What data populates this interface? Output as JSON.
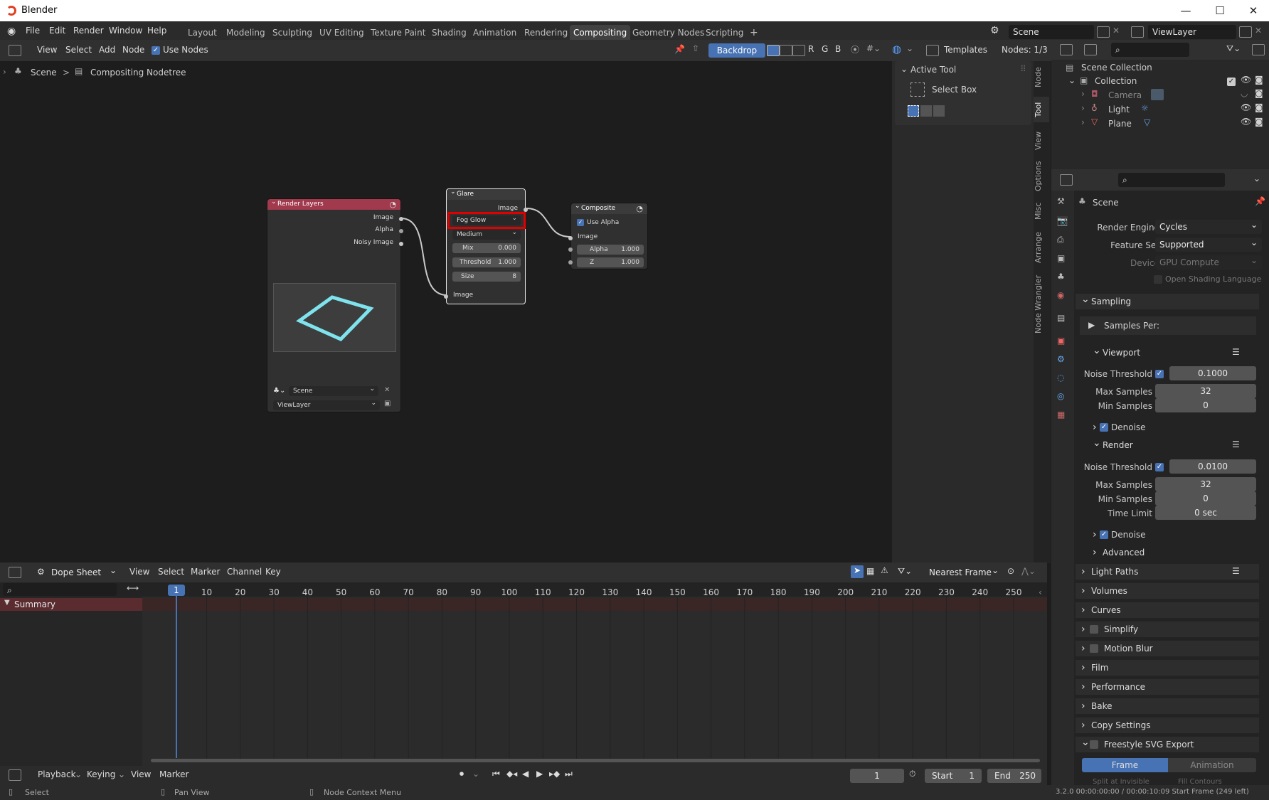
{
  "window": {
    "title": "Blender",
    "min": "—",
    "max": "☐",
    "close": "✕"
  },
  "menu": [
    "File",
    "Edit",
    "Render",
    "Window",
    "Help"
  ],
  "workspaces": [
    "Layout",
    "Modeling",
    "Sculpting",
    "UV Editing",
    "Texture Paint",
    "Shading",
    "Animation",
    "Rendering",
    "Compositing",
    "Geometry Nodes",
    "Scripting"
  ],
  "workspace_add": "+",
  "active_workspace": "Compositing",
  "scene_field": "Scene",
  "viewlayer_field": "ViewLayer",
  "node_header": {
    "menus": [
      "View",
      "Select",
      "Add",
      "Node"
    ],
    "use_nodes": "Use Nodes",
    "backdrop": "Backdrop",
    "channels": [
      "R",
      "G",
      "B"
    ],
    "templates": "Templates",
    "nodes_count": "Nodes: 1/3"
  },
  "breadcrumb": {
    "scene": "Scene",
    "sep": ">",
    "tree": "Compositing Nodetree"
  },
  "sidebar_tabs": [
    "Node",
    "Tool",
    "View",
    "Options",
    "Misc",
    "Arrange",
    "Node Wrangler"
  ],
  "active_tool": {
    "header": "Active Tool",
    "tool": "Select Box"
  },
  "nodes": {
    "render_layers": {
      "title": "Render Layers",
      "outputs": [
        "Image",
        "Alpha",
        "Noisy Image"
      ],
      "scene": "Scene",
      "viewlayer": "ViewLayer"
    },
    "glare": {
      "title": "Glare",
      "output": "Image",
      "type": "Fog Glow",
      "quality": "Medium",
      "mix_label": "Mix",
      "mix": "0.000",
      "threshold_label": "Threshold",
      "threshold": "1.000",
      "size_label": "Size",
      "size": "8",
      "input": "Image"
    },
    "composite": {
      "title": "Composite",
      "use_alpha": "Use Alpha",
      "input": "Image",
      "alpha_label": "Alpha",
      "alpha": "1.000",
      "z_label": "Z",
      "z": "1.000"
    }
  },
  "outliner": {
    "root": "Scene Collection",
    "collection": "Collection",
    "items": [
      "Camera",
      "Light",
      "Plane"
    ]
  },
  "properties": {
    "scene": "Scene",
    "render_engine_label": "Render Engine",
    "render_engine": "Cycles",
    "feature_set_label": "Feature Set",
    "feature_set": "Supported",
    "device_label": "Device",
    "device": "GPU Compute",
    "osl": "Open Shading Language",
    "sampling": "Sampling",
    "samples_per": "Samples Per:",
    "viewport": "Viewport",
    "noise_threshold": "Noise Threshold",
    "vp_noise": "0.1000",
    "max_samples": "Max Samples",
    "vp_max": "32",
    "min_samples": "Min Samples",
    "vp_min": "0",
    "denoise": "Denoise",
    "render": "Render",
    "r_noise": "0.0100",
    "r_max": "32",
    "r_min": "0",
    "time_limit": "Time Limit",
    "r_time": "0 sec",
    "advanced": "Advanced",
    "panels": [
      "Light Paths",
      "Volumes",
      "Curves",
      "Simplify",
      "Motion Blur",
      "Film",
      "Performance",
      "Bake",
      "Copy Settings",
      "Freestyle SVG Export"
    ],
    "frame_tab": "Frame",
    "animation_tab": "Animation",
    "cut1": "Split at Invisible",
    "cut2": "Fill Contours"
  },
  "dopesheet": {
    "mode": "Dope Sheet",
    "menus": [
      "View",
      "Select",
      "Marker",
      "Channel",
      "Key"
    ],
    "snap": "Nearest Frame",
    "frames": [
      "1",
      "10",
      "20",
      "30",
      "40",
      "50",
      "60",
      "70",
      "80",
      "90",
      "100",
      "110",
      "120",
      "130",
      "140",
      "150",
      "160",
      "170",
      "180",
      "190",
      "200",
      "210",
      "220",
      "230",
      "240",
      "250"
    ],
    "summary": "Summary",
    "current_frame": "1"
  },
  "playback": {
    "menus": [
      "Playback",
      "Keying",
      "View",
      "Marker"
    ],
    "frame": "1",
    "start_label": "Start",
    "start": "1",
    "end_label": "End",
    "end": "250"
  },
  "statusbar": {
    "select": "Select",
    "pan": "Pan View",
    "ctx": "Node Context Menu",
    "info": "3.2.0   00:00:00:00 / 00:00:10:09   Start Frame (249 left)"
  },
  "colors": {
    "accent": "#4772b3",
    "highlight": "#e00000",
    "render_layers_header": "#a13a4d",
    "plane_outline": "#7fe3ee"
  }
}
